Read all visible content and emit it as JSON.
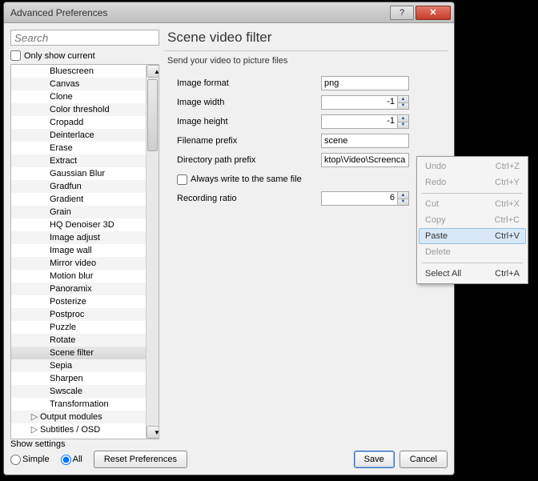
{
  "window": {
    "title": "Advanced Preferences"
  },
  "search": {
    "placeholder": "Search"
  },
  "only_current_label": "Only show current",
  "tree_items": [
    {
      "label": "Bluescreen"
    },
    {
      "label": "Canvas"
    },
    {
      "label": "Clone"
    },
    {
      "label": "Color threshold"
    },
    {
      "label": "Cropadd"
    },
    {
      "label": "Deinterlace"
    },
    {
      "label": "Erase"
    },
    {
      "label": "Extract"
    },
    {
      "label": "Gaussian Blur"
    },
    {
      "label": "Gradfun"
    },
    {
      "label": "Gradient"
    },
    {
      "label": "Grain"
    },
    {
      "label": "HQ Denoiser 3D"
    },
    {
      "label": "Image adjust"
    },
    {
      "label": "Image wall"
    },
    {
      "label": "Mirror video"
    },
    {
      "label": "Motion blur"
    },
    {
      "label": "Panoramix"
    },
    {
      "label": "Posterize"
    },
    {
      "label": "Postproc"
    },
    {
      "label": "Puzzle"
    },
    {
      "label": "Rotate"
    },
    {
      "label": "Scene filter",
      "selected": true
    },
    {
      "label": "Sepia"
    },
    {
      "label": "Sharpen"
    },
    {
      "label": "Swscale"
    },
    {
      "label": "Transformation"
    },
    {
      "label": "Output modules",
      "parent": true,
      "expandable": true
    },
    {
      "label": "Subtitles / OSD",
      "parent": true,
      "expandable": true
    }
  ],
  "panel": {
    "title": "Scene video filter",
    "description": "Send your video to picture files",
    "labels": {
      "image_format": "Image format",
      "image_width": "Image width",
      "image_height": "Image height",
      "filename_prefix": "Filename prefix",
      "directory_prefix": "Directory path prefix",
      "always_write": "Always write to the same file",
      "recording_ratio": "Recording ratio"
    },
    "values": {
      "image_format": "png",
      "image_width": "-1",
      "image_height": "-1",
      "filename_prefix": "scene",
      "directory_prefix": "ktop\\Video\\Screencaps",
      "recording_ratio": "6"
    }
  },
  "bottom": {
    "show_settings": "Show settings",
    "simple": "Simple",
    "all": "All",
    "reset": "Reset Preferences",
    "save": "Save",
    "cancel": "Cancel"
  },
  "ctx": {
    "undo": {
      "label": "Undo",
      "shortcut": "Ctrl+Z"
    },
    "redo": {
      "label": "Redo",
      "shortcut": "Ctrl+Y"
    },
    "cut": {
      "label": "Cut",
      "shortcut": "Ctrl+X"
    },
    "copy": {
      "label": "Copy",
      "shortcut": "Ctrl+C"
    },
    "paste": {
      "label": "Paste",
      "shortcut": "Ctrl+V"
    },
    "delete": {
      "label": "Delete"
    },
    "selectall": {
      "label": "Select All",
      "shortcut": "Ctrl+A"
    }
  }
}
